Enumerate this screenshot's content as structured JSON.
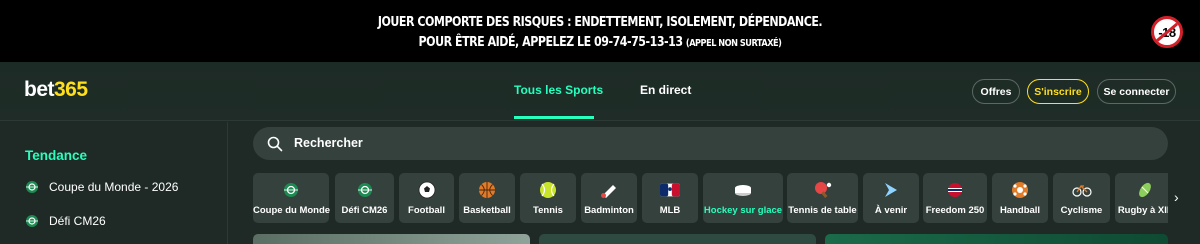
{
  "warning": {
    "line1": "JOUER COMPORTE DES RISQUES : ENDETTEMENT, ISOLEMENT, DÉPENDANCE.",
    "line2": "POUR ÊTRE AIDÉ, APPELEZ LE 09-74-75-13-13",
    "line2_small": "(APPEL NON SURTAXÉ)",
    "age_badge": "-18"
  },
  "header": {
    "logo_part1": "bet",
    "logo_part2": "365",
    "tabs": [
      {
        "label": "Tous les Sports",
        "active": true
      },
      {
        "label": "En direct",
        "active": false
      }
    ],
    "buttons": {
      "offers": "Offres",
      "register": "S'inscrire",
      "login": "Se connecter"
    }
  },
  "sidebar": {
    "title": "Tendance",
    "items": [
      {
        "label": "Coupe du Monde - 2026",
        "icon": "world-cup-icon"
      },
      {
        "label": "Défi CM26",
        "icon": "world-cup-icon"
      }
    ]
  },
  "search": {
    "placeholder": "Rechercher"
  },
  "sports": [
    {
      "label": "Coupe du Monde",
      "icon": "world-cup-icon"
    },
    {
      "label": "Défi CM26",
      "icon": "world-cup-icon"
    },
    {
      "label": "Football",
      "icon": "football-icon"
    },
    {
      "label": "Basketball",
      "icon": "basketball-icon"
    },
    {
      "label": "Tennis",
      "icon": "tennis-icon"
    },
    {
      "label": "Badminton",
      "icon": "badminton-icon"
    },
    {
      "label": "MLB",
      "icon": "mlb-icon"
    },
    {
      "label": "Hockey sur glace",
      "icon": "ice-hockey-icon",
      "highlight": true
    },
    {
      "label": "Tennis de table",
      "icon": "table-tennis-icon"
    },
    {
      "label": "À venir",
      "icon": "upcoming-icon"
    },
    {
      "label": "Freedom 250",
      "icon": "freedom-250-icon"
    },
    {
      "label": "Handball",
      "icon": "handball-icon"
    },
    {
      "label": "Cyclisme",
      "icon": "cycling-icon"
    },
    {
      "label": "Rugby à XIII",
      "icon": "rugby-icon"
    }
  ],
  "colors": {
    "accent": "#26ffbe",
    "brand_yellow": "#ffdf1b",
    "background": "#1f2a26",
    "tile": "#35413d"
  }
}
